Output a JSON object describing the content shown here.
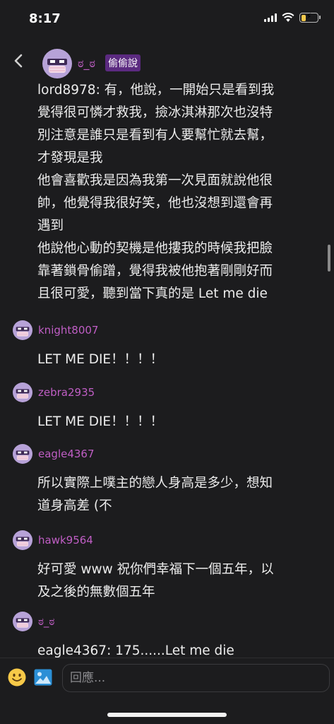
{
  "status": {
    "time": "8:17"
  },
  "header": {
    "name": "ಠ_ಠ",
    "badge": "偷偷說"
  },
  "post": {
    "lines": [
      "lord8978: 有，他說，一開始只是看到我",
      "覺得很可憐才救我，撿冰淇淋那次也沒特",
      "別注意是誰只是看到有人要幫忙就去幫，",
      "才發現是我",
      "他會喜歡我是因為我第一次見面就說他很",
      "帥，他覺得我很好笑，他也沒想到還會再",
      "遇到",
      "他說他心動的契機是他摟我的時候我把臉",
      "靠著鎖骨偷蹭，覺得我被他抱著剛剛好而",
      "且很可愛，聽到當下真的是 Let me die"
    ]
  },
  "comments": [
    {
      "user": "knight8007",
      "lines": [
        "LET ME DIE！！！！"
      ]
    },
    {
      "user": "zebra2935",
      "lines": [
        "LET ME DIE！！！！"
      ]
    },
    {
      "user": "eagle4367",
      "lines": [
        "所以實際上噗主的戀人身高是多少，想知",
        "道身高差 (不"
      ]
    },
    {
      "user": "hawk9564",
      "lines": [
        "好可愛 www 祝你們幸福下一個五年，以",
        "及之後的無數個五年"
      ]
    },
    {
      "user": "ಠ_ಠ",
      "lines": [
        "eagle4367: 175......Let me die"
      ]
    }
  ],
  "reply": {
    "placeholder": "回應..."
  },
  "colors": {
    "accent": "#c05ec5",
    "badge_bg": "#5b2a80",
    "background": "#1c1c1e",
    "battery": "#f2c94c"
  }
}
